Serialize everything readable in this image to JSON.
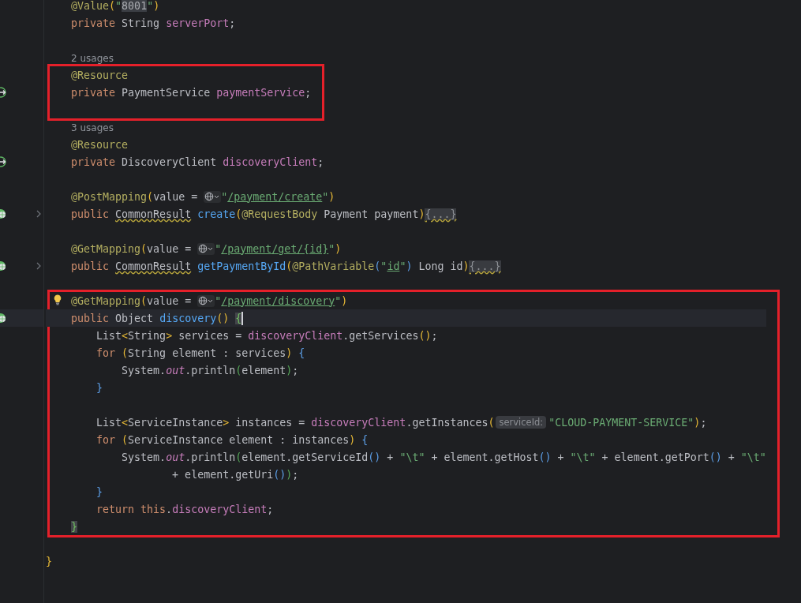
{
  "blocks": [
    {
      "boxed": false,
      "lines": [
        {
          "tokens": [
            {
              "kind": "annotation",
              "text": "    @Value"
            },
            {
              "kind": "p1",
              "text": "("
            },
            {
              "kind": "string",
              "text": "\""
            },
            {
              "kind": "string-hl",
              "text": "8001"
            },
            {
              "kind": "string",
              "text": "\""
            },
            {
              "kind": "p1",
              "text": ")"
            }
          ]
        },
        {
          "tokens": [
            {
              "kind": "keyword",
              "text": "    private "
            },
            {
              "kind": "plain",
              "text": "String "
            },
            {
              "kind": "field",
              "text": "serverPort"
            },
            {
              "kind": "plain",
              "text": ";"
            }
          ]
        },
        {
          "kind": "blank"
        },
        {
          "tokens": [
            {
              "kind": "usage",
              "text": "    2 usages"
            }
          ]
        }
      ]
    },
    {
      "boxed": true,
      "lines": [
        {
          "tokens": [
            {
              "kind": "annotation",
              "text": "    @Resource"
            }
          ]
        },
        {
          "gutter_icon": {
            "kind": "bean"
          },
          "tokens": [
            {
              "kind": "keyword",
              "text": "    private "
            },
            {
              "kind": "plain",
              "text": "PaymentService "
            },
            {
              "kind": "field",
              "text": "paymentService"
            },
            {
              "kind": "plain",
              "text": ";"
            }
          ]
        },
        {
          "kind": "blank"
        }
      ]
    },
    {
      "boxed": false,
      "lines": [
        {
          "tokens": [
            {
              "kind": "usage",
              "text": "    3 usages"
            }
          ]
        },
        {
          "tokens": [
            {
              "kind": "annotation",
              "text": "    @Resource"
            }
          ]
        },
        {
          "gutter_icon": {
            "kind": "bean"
          },
          "tokens": [
            {
              "kind": "keyword",
              "text": "    private "
            },
            {
              "kind": "plain",
              "text": "DiscoveryClient "
            },
            {
              "kind": "field",
              "text": "discoveryClient"
            },
            {
              "kind": "plain",
              "text": ";"
            }
          ]
        },
        {
          "kind": "blank"
        },
        {
          "tokens": [
            {
              "kind": "annotation",
              "text": "    @PostMapping"
            },
            {
              "kind": "p1",
              "text": "("
            },
            {
              "kind": "plain",
              "text": "value = "
            },
            {
              "kind": "globe"
            },
            {
              "kind": "string",
              "text": "\""
            },
            {
              "kind": "url",
              "text": "/payment/create"
            },
            {
              "kind": "string",
              "text": "\""
            },
            {
              "kind": "p1",
              "text": ")"
            }
          ]
        },
        {
          "gutter_icon": {
            "kind": "endpoint"
          },
          "fold": true,
          "tokens": [
            {
              "kind": "keyword",
              "text": "    public "
            },
            {
              "kind": "type-warn",
              "text": "CommonResult"
            },
            {
              "kind": "method",
              "text": " create"
            },
            {
              "kind": "p1",
              "text": "("
            },
            {
              "kind": "annotation",
              "text": "@RequestBody"
            },
            {
              "kind": "plain",
              "text": " Payment payment"
            },
            {
              "kind": "p1",
              "text": ")"
            },
            {
              "kind": "folded",
              "text": "{...}"
            }
          ]
        },
        {
          "kind": "blank"
        },
        {
          "tokens": [
            {
              "kind": "annotation",
              "text": "    @GetMapping"
            },
            {
              "kind": "p1",
              "text": "("
            },
            {
              "kind": "plain",
              "text": "value = "
            },
            {
              "kind": "globe"
            },
            {
              "kind": "string",
              "text": "\""
            },
            {
              "kind": "url",
              "text": "/payment/get/{id}"
            },
            {
              "kind": "string",
              "text": "\""
            },
            {
              "kind": "p1",
              "text": ")"
            }
          ]
        },
        {
          "gutter_icon": {
            "kind": "endpoint"
          },
          "fold": true,
          "tokens": [
            {
              "kind": "keyword",
              "text": "    public "
            },
            {
              "kind": "type-warn",
              "text": "CommonResult"
            },
            {
              "kind": "method",
              "text": " getPaymentById"
            },
            {
              "kind": "p1",
              "text": "("
            },
            {
              "kind": "annotation",
              "text": "@PathVariable"
            },
            {
              "kind": "p2",
              "text": "("
            },
            {
              "kind": "string",
              "text": "\""
            },
            {
              "kind": "url",
              "text": "id"
            },
            {
              "kind": "string",
              "text": "\""
            },
            {
              "kind": "p2",
              "text": ")"
            },
            {
              "kind": "plain",
              "text": " Long id"
            },
            {
              "kind": "p1",
              "text": ")"
            },
            {
              "kind": "folded",
              "text": "{...}"
            }
          ]
        },
        {
          "kind": "blank"
        }
      ]
    },
    {
      "boxed": true,
      "lines": [
        {
          "bulb": true,
          "tokens": [
            {
              "kind": "annotation",
              "text": "    @GetMapping"
            },
            {
              "kind": "p1",
              "text": "("
            },
            {
              "kind": "plain",
              "text": "value = "
            },
            {
              "kind": "globe"
            },
            {
              "kind": "string",
              "text": "\""
            },
            {
              "kind": "url",
              "text": "/payment/discovery"
            },
            {
              "kind": "string",
              "text": "\""
            },
            {
              "kind": "p1",
              "text": ")"
            }
          ]
        },
        {
          "gutter_icon": {
            "kind": "endpoint"
          },
          "current": true,
          "tokens": [
            {
              "kind": "keyword",
              "text": "    public "
            },
            {
              "kind": "plain",
              "text": "Object "
            },
            {
              "kind": "method",
              "text": "discovery"
            },
            {
              "kind": "p1",
              "text": "() "
            },
            {
              "kind": "brace-match",
              "text": "{"
            },
            {
              "kind": "caret"
            }
          ]
        },
        {
          "tokens": [
            {
              "kind": "plain",
              "text": "        List"
            },
            {
              "kind": "p1",
              "text": "<"
            },
            {
              "kind": "plain",
              "text": "String"
            },
            {
              "kind": "p1",
              "text": ">"
            },
            {
              "kind": "plain",
              "text": " services = "
            },
            {
              "kind": "field",
              "text": "discoveryClient"
            },
            {
              "kind": "plain",
              "text": ".getServices"
            },
            {
              "kind": "p1",
              "text": "()"
            },
            {
              "kind": "plain",
              "text": ";"
            }
          ]
        },
        {
          "tokens": [
            {
              "kind": "keyword",
              "text": "        for "
            },
            {
              "kind": "p1",
              "text": "("
            },
            {
              "kind": "plain",
              "text": "String element : services"
            },
            {
              "kind": "p1",
              "text": ")"
            },
            {
              "kind": "p2",
              "text": " {"
            }
          ]
        },
        {
          "tokens": [
            {
              "kind": "plain",
              "text": "            System."
            },
            {
              "kind": "static",
              "text": "out"
            },
            {
              "kind": "plain",
              "text": ".println"
            },
            {
              "kind": "p3",
              "text": "("
            },
            {
              "kind": "plain",
              "text": "element"
            },
            {
              "kind": "p3",
              "text": ")"
            },
            {
              "kind": "plain",
              "text": ";"
            }
          ]
        },
        {
          "tokens": [
            {
              "kind": "p2",
              "text": "        }"
            }
          ]
        },
        {
          "kind": "blank"
        },
        {
          "tokens": [
            {
              "kind": "plain",
              "text": "        List"
            },
            {
              "kind": "p1",
              "text": "<"
            },
            {
              "kind": "plain",
              "text": "ServiceInstance"
            },
            {
              "kind": "p1",
              "text": ">"
            },
            {
              "kind": "plain",
              "text": " instances = "
            },
            {
              "kind": "field",
              "text": "discoveryClient"
            },
            {
              "kind": "plain",
              "text": ".getInstances"
            },
            {
              "kind": "p1",
              "text": "("
            },
            {
              "kind": "hint",
              "text": "serviceId:"
            },
            {
              "kind": "string",
              "text": "\"CLOUD-PAYMENT-SERVICE\""
            },
            {
              "kind": "p1",
              "text": ")"
            },
            {
              "kind": "plain",
              "text": ";"
            }
          ]
        },
        {
          "tokens": [
            {
              "kind": "keyword",
              "text": "        for "
            },
            {
              "kind": "p1",
              "text": "("
            },
            {
              "kind": "plain",
              "text": "ServiceInstance element : instances"
            },
            {
              "kind": "p1",
              "text": ")"
            },
            {
              "kind": "p2",
              "text": " {"
            }
          ]
        },
        {
          "tokens": [
            {
              "kind": "plain",
              "text": "            System."
            },
            {
              "kind": "static",
              "text": "out"
            },
            {
              "kind": "plain",
              "text": ".println"
            },
            {
              "kind": "p3",
              "text": "("
            },
            {
              "kind": "plain",
              "text": "element.getServiceId"
            },
            {
              "kind": "p2",
              "text": "()"
            },
            {
              "kind": "plain",
              "text": " + "
            },
            {
              "kind": "string",
              "text": "\"\\t\""
            },
            {
              "kind": "plain",
              "text": " + element.getHost"
            },
            {
              "kind": "p2",
              "text": "()"
            },
            {
              "kind": "plain",
              "text": " + "
            },
            {
              "kind": "string",
              "text": "\"\\t\""
            },
            {
              "kind": "plain",
              "text": " + element.getPort"
            },
            {
              "kind": "p2",
              "text": "()"
            },
            {
              "kind": "plain",
              "text": " + "
            },
            {
              "kind": "string",
              "text": "\"\\t\""
            }
          ]
        },
        {
          "tokens": [
            {
              "kind": "plain",
              "text": "                    + element.getUri"
            },
            {
              "kind": "p2",
              "text": "()"
            },
            {
              "kind": "p3",
              "text": ")"
            },
            {
              "kind": "plain",
              "text": ";"
            }
          ]
        },
        {
          "tokens": [
            {
              "kind": "p2",
              "text": "        }"
            }
          ]
        },
        {
          "tokens": [
            {
              "kind": "keyword",
              "text": "        return this"
            },
            {
              "kind": "plain",
              "text": "."
            },
            {
              "kind": "field",
              "text": "discoveryClient"
            },
            {
              "kind": "plain",
              "text": ";"
            }
          ]
        },
        {
          "tokens": [
            {
              "kind": "brace-match",
              "text": "    }"
            }
          ]
        }
      ]
    },
    {
      "boxed": false,
      "lines": [
        {
          "kind": "blank"
        },
        {
          "tokens": [
            {
              "kind": "p1",
              "text": "}"
            }
          ]
        }
      ]
    }
  ]
}
